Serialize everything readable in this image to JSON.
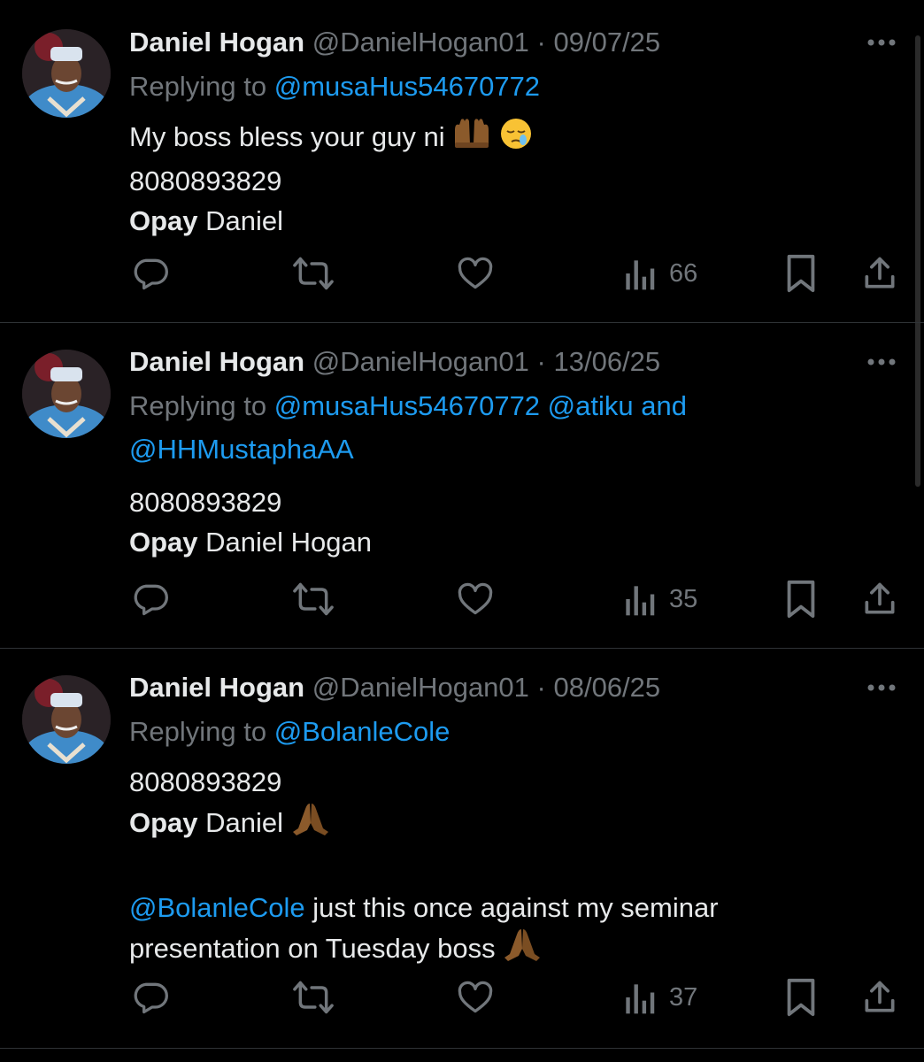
{
  "colors": {
    "background": "#000000",
    "name": "#e7e9ea",
    "meta": "#71767b",
    "mention": "#1d9bf0",
    "divider": "#2f3336"
  },
  "tweets": [
    {
      "name": "Daniel Hogan",
      "handle": "@DanielHogan01",
      "sep": "·",
      "date": "09/07/25",
      "replying_prefix": "Replying to",
      "mentions": [
        "@musaHus54670772"
      ],
      "lines": [
        "My boss bless your guy ni",
        "8080893829"
      ],
      "line1_emojis": [
        "palms-up-together-emoji",
        "sleepy-face-emoji"
      ],
      "bank_bold": "Opay",
      "bank_rest": " Daniel",
      "views": "66"
    },
    {
      "name": "Daniel Hogan",
      "handle": "@DanielHogan01",
      "sep": "·",
      "date": "13/06/25",
      "replying_prefix": "Replying to",
      "mentions": [
        "@musaHus54670772",
        "@atiku",
        "@HHMustaphaAA"
      ],
      "mention_joiner": "and",
      "lines": [
        "8080893829"
      ],
      "bank_bold": "Opay",
      "bank_rest": " Daniel Hogan",
      "views": "35"
    },
    {
      "name": "Daniel Hogan",
      "handle": "@DanielHogan01",
      "sep": "·",
      "date": "08/06/25",
      "replying_prefix": "Replying to",
      "mentions": [
        "@BolanleCole"
      ],
      "lines": [
        "8080893829"
      ],
      "bank_bold": "Opay",
      "bank_rest": " Daniel",
      "extra_mention": "@BolanleCole",
      "extra_text_1": " just this once against my seminar",
      "extra_text_2": "presentation on Tuesday boss",
      "views": "37"
    }
  ],
  "icons": [
    "more-icon",
    "reply-icon",
    "retweet-icon",
    "like-icon",
    "views-icon",
    "bookmark-icon",
    "share-icon",
    "praying-hands-emoji"
  ]
}
